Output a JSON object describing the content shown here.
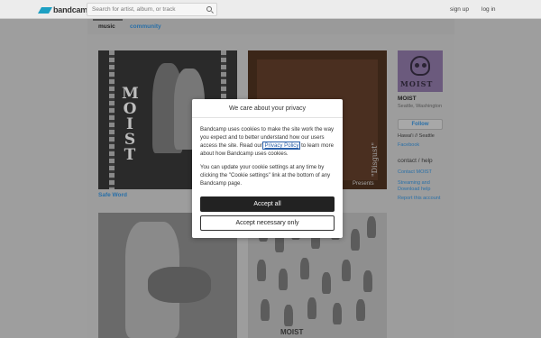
{
  "header": {
    "logo_text": "bandcamp",
    "search_placeholder": "Search for artist, album, or track",
    "signup": "sign up",
    "login": "log in"
  },
  "tabs": {
    "music": "music",
    "community": "community"
  },
  "covers": {
    "c1_text": "MOIST",
    "c2_word": "\"Disgust\"",
    "c2_presents": "Presents",
    "c2_partial": "ST",
    "c4_bottom": "MOIST"
  },
  "releases": {
    "first_title": "Safe Word"
  },
  "sidebar": {
    "photo_text": "MOIST",
    "band_name": "MOIST",
    "location": "Seattle, Washington",
    "follow_label": "Follow",
    "bio": "Hawai'i // Seattle",
    "facebook": "Facebook",
    "contact_heading": "contact / help",
    "contact_link": "Contact MOIST",
    "streaming_link": "Streaming and Download help",
    "report_link": "Report this account"
  },
  "modal": {
    "title": "We care about your privacy",
    "p1_before": "Bandcamp uses cookies to make the site work the way you expect and to better understand how our users access the site. Read our ",
    "p1_link": "Privacy Policy",
    "p1_after": " to learn more about how Bandcamp uses cookies.",
    "p2": "You can update your cookie settings at any time by clicking the \"Cookie settings\" link at the bottom of any Bandcamp page.",
    "accept_all": "Accept all",
    "accept_necessary": "Accept necessary only"
  },
  "colors": {
    "brand": "#1da0c3",
    "link": "#2a70a8",
    "primary_button": "#222222"
  }
}
